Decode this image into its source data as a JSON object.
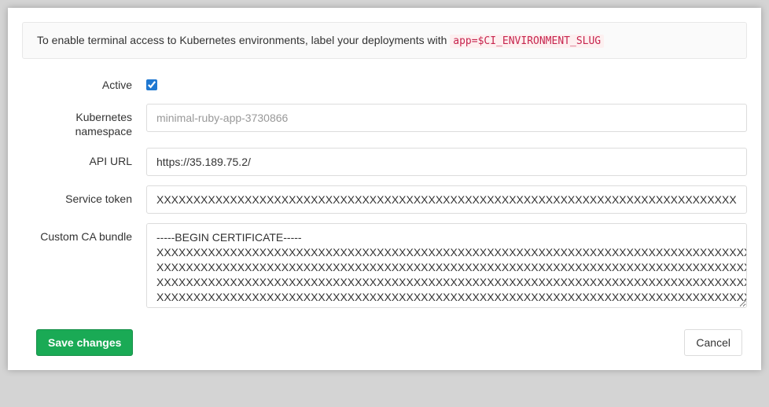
{
  "info": {
    "text_before": "To enable terminal access to Kubernetes environments, label your deployments with ",
    "code": "app=$CI_ENVIRONMENT_SLUG"
  },
  "fields": {
    "active": {
      "label": "Active",
      "checked": true
    },
    "namespace": {
      "label": "Kubernetes namespace",
      "placeholder": "minimal-ruby-app-3730866",
      "value": ""
    },
    "api_url": {
      "label": "API URL",
      "value": "https://35.189.75.2/"
    },
    "service_token": {
      "label": "Service token",
      "value": "XXXXXXXXXXXXXXXXXXXXXXXXXXXXXXXXXXXXXXXXXXXXXXXXXXXXXXXXXXXXXXXXXXXXXXXXXXXXXXXXXXXXXXXXXXXXXXXXXXXXXXXXXXXXXXXXXXXXXXXX"
    },
    "ca_bundle": {
      "label": "Custom CA bundle",
      "value": "-----BEGIN CERTIFICATE-----\nXXXXXXXXXXXXXXXXXXXXXXXXXXXXXXXXXXXXXXXXXXXXXXXXXXXXXXXXXXXXXXXXXXXXXXXXXXXXXXXXXXXXXXXXXXXXXXXXXXXXXXXXXXXXXXXXXXXX\nXXXXXXXXXXXXXXXXXXXXXXXXXXXXXXXXXXXXXXXXXXXXXXXXXXXXXXXXXXXXXXXXXXXXXXXXXXXXXXXXXXXXXXXXXXXXXXXXXXXXXXXXXXXXXXXXXXXX\nXXXXXXXXXXXXXXXXXXXXXXXXXXXXXXXXXXXXXXXXXXXXXXXXXXXXXXXXXXXXXXXXXXXXXXXXXXXXXXXXXXXXXXXXXXXXXXXXXXXXXXXXXXXXXXXXXXXX\nXXXXXXXXXXXXXXXXXXXXXXXXXXXXXXXXXXXXXXXXXXXXXXXXXXXXXXXXXXXXXXXXXXXXXXXXXXXXXXXXXXXXXXXXXXXXXXXXXXXXXXXXXXXXXXXXXXXX\nXXXXXXXXXXXXXXXXXXXXXXXXXXXXXXXXXXXXXXXXXXXXXXXXXXXXXXXXXXXXXXXXXXXXXXXXXXXXXXXXXXXXXXXXXXXXXXXXXXXXXXXXXXXXXXXXXXXX"
    }
  },
  "buttons": {
    "save": "Save changes",
    "cancel": "Cancel"
  }
}
